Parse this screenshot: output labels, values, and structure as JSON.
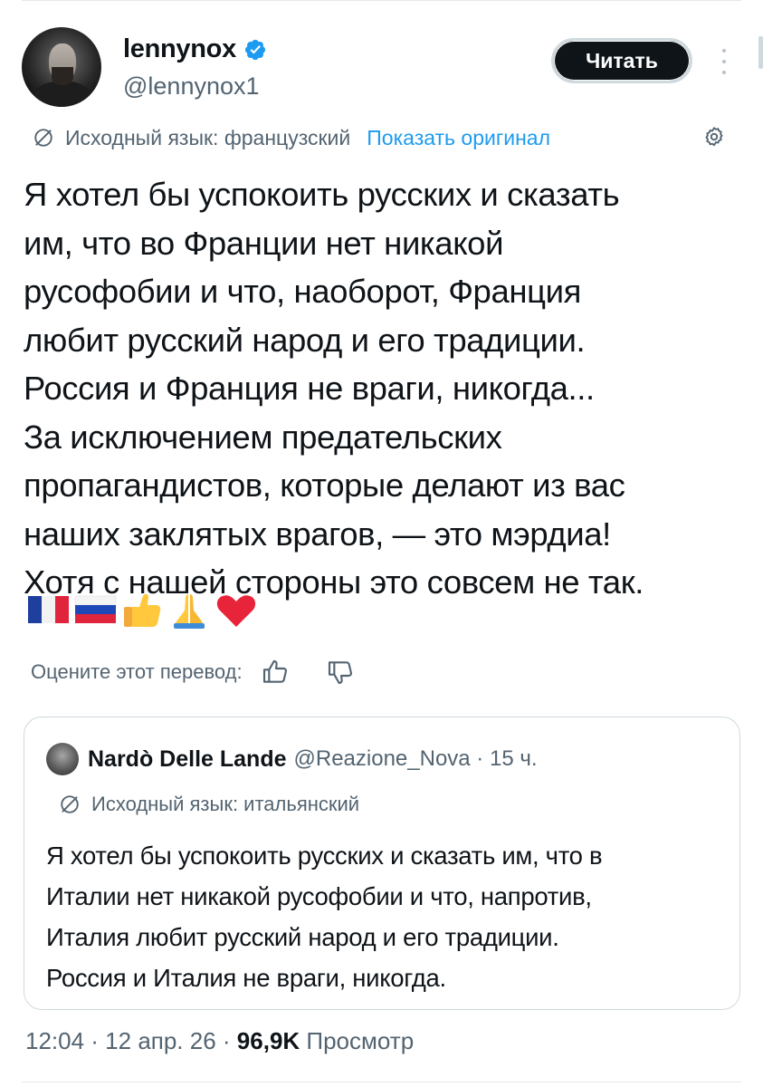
{
  "author": {
    "display_name": "lennynox",
    "handle": "@lennynox1",
    "verified": true,
    "follow_label": "Читать"
  },
  "translation": {
    "source_label": "Исходный язык: французский",
    "show_original": "Показать оригинал"
  },
  "tweet_lines": [
    "Я хотел бы успокоить русских и сказать",
    "им, что во Франции нет никакой",
    "русофобии и что, наоборот, Франция",
    "любит русский народ и его традиции.",
    "Россия и Франция не враги, никогда...",
    "За исключением предательских",
    "пропагандистов, которые делают из вас",
    "наших заклятых врагов, — это мэрдиа!",
    "Хотя с нашей стороны это совсем не так."
  ],
  "emojis": [
    "flag-france",
    "flag-russia",
    "thumbs-up",
    "folded-hands",
    "red-heart"
  ],
  "rate": {
    "label": "Оцените этот перевод:"
  },
  "quote": {
    "display_name": "Nardò Delle Lande",
    "handle_time": "@Reazione_Nova · 15 ч.",
    "source_label": "Исходный язык: итальянский",
    "lines": [
      "Я хотел бы успокоить русских и сказать им, что в",
      "Италии нет никакой русофобии и что, напротив,",
      "Италия любит русский народ и его традиции.",
      "Россия и Италия не враги, никогда."
    ]
  },
  "meta": {
    "time_date": "12:04 · 12 апр. 26 · ",
    "views_count": "96,9K",
    "views_label": " Просмотр"
  },
  "colors": {
    "accent": "#1d9bf0",
    "secondary_text": "#536471",
    "primary_text": "#0f1419",
    "border": "#cfd9de"
  }
}
